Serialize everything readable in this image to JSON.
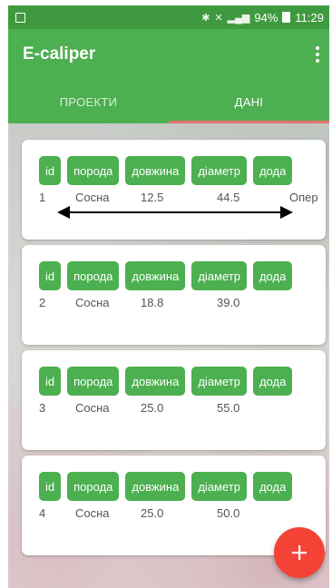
{
  "status_bar": {
    "battery": "94%",
    "time": "11:29"
  },
  "app": {
    "title": "E-caliper"
  },
  "tabs": [
    {
      "label": "ПРОЕКТИ",
      "active": false
    },
    {
      "label": "ДАНІ",
      "active": true
    }
  ],
  "columns": {
    "id": "id",
    "species": "порода",
    "length": "довжина",
    "diameter": "діаметр",
    "extra": "дода"
  },
  "rows": [
    {
      "id": "1",
      "species": "Сосна",
      "length": "12.5",
      "diameter": "44.5",
      "extra": "Опер"
    },
    {
      "id": "2",
      "species": "Сосна",
      "length": "18.8",
      "diameter": "39.0",
      "extra": ""
    },
    {
      "id": "3",
      "species": "Сосна",
      "length": "25.0",
      "diameter": "55.0",
      "extra": ""
    },
    {
      "id": "4",
      "species": "Сосна",
      "length": "25.0",
      "diameter": "50.0",
      "extra": ""
    }
  ],
  "colors": {
    "primary": "#4caf50",
    "status_bar": "#3f9a3f",
    "accent": "#f44336",
    "tab_indicator": "#e57373"
  },
  "icons": {
    "menu": "more-vert-icon",
    "fab": "plus-icon"
  }
}
